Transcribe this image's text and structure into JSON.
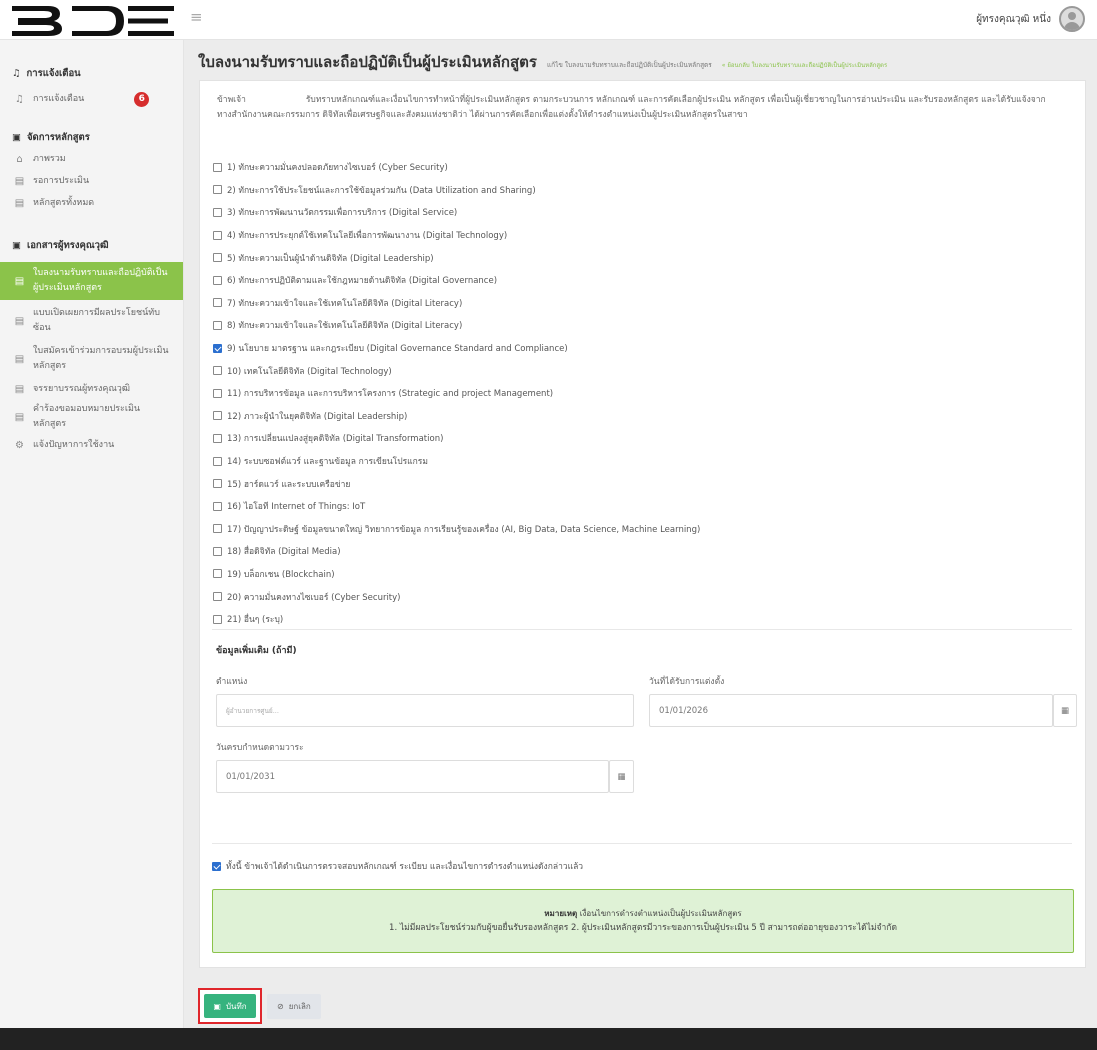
{
  "app": {
    "logo_text": "BDE",
    "user_name": "ผู้ทรงคุณวุฒิ หนึ่ง"
  },
  "sidebar": {
    "section_notifications": "การแจ้งเตือน",
    "item_notifications": "การแจ้งเตือน",
    "notification_count": "6",
    "section_curriculum": "จัดการหลักสูตร",
    "item_overview": "ภาพรวม",
    "item_pending": "รอการประเมิน",
    "item_all_courses": "หลักสูตรทั้งหมด",
    "section_documents": "เอกสารผู้ทรงคุณวุฒิ",
    "item_acknowledgement": "ใบลงนามรับทราบและถือปฏิบัติเป็นผู้ประเมินหลักสูตร",
    "item_conflict": "แบบเปิดเผยการมีผลประโยชน์ทับซ้อน",
    "item_training": "ใบสมัครเข้าร่วมการอบรมผู้ประเมินหลักสูตร",
    "item_ethics": "จรรยาบรรณผู้ทรงคุณวุฒิ",
    "item_assignment": "คำร้องขอมอบหมายประเมินหลักสูตร",
    "item_report": "แจ้งปัญหาการใช้งาน"
  },
  "page": {
    "title": "ใบลงนามรับทราบและถือปฏิบัติเป็นผู้ประเมินหลักสูตร",
    "subtitle": "แก้ไข ใบลงนามรับทราบและถือปฏิบัติเป็นผู้ประเมินหลักสูตร",
    "breadcrumb": "« ย้อนกลับ ใบลงนามรับทราบและถือปฏิบัติเป็นผู้ประเมินหลักสูตร"
  },
  "form": {
    "intro_prefix": "ข้าพเจ้า",
    "intro_text": "รับทราบหลักเกณฑ์และเงื่อนไขการทำหน้าที่ผู้ประเมินหลักสูตร ตามกระบวนการ หลักเกณฑ์ และการคัดเลือกผู้ประเมิน หลักสูตร เพื่อเป็นผู้เชี่ยวชาญในการอ่านประเมิน และรับรองหลักสูตร และได้รับแจ้งจาก",
    "intro_text2": "ทางสำนักงานคณะกรรมการ ดิจิทัลเพื่อเศรษฐกิจและสังคมแห่งชาติว่า ได้ผ่านการคัดเลือกเพื่อแต่งตั้งให้ดำรงตำแหน่งเป็นผู้ประเมินหลักสูตรในสาขา",
    "skills": [
      {
        "label": "1) ทักษะความมั่นคงปลอดภัยทางไซเบอร์ (Cyber Security)",
        "checked": false
      },
      {
        "label": "2) ทักษะการใช้ประโยชน์และการใช้ข้อมูลร่วมกัน (Data Utilization and Sharing)",
        "checked": false
      },
      {
        "label": "3) ทักษะการพัฒนานวัตกรรมเพื่อการบริการ (Digital Service)",
        "checked": false
      },
      {
        "label": "4) ทักษะการประยุกต์ใช้เทคโนโลยีเพื่อการพัฒนางาน (Digital Technology)",
        "checked": false
      },
      {
        "label": "5) ทักษะความเป็นผู้นำด้านดิจิทัล (Digital Leadership)",
        "checked": false
      },
      {
        "label": "6) ทักษะการปฏิบัติตามและใช้กฎหมายด้านดิจิทัล (Digital Governance)",
        "checked": false
      },
      {
        "label": "7) ทักษะความเข้าใจและใช้เทคโนโลยีดิจิทัล (Digital Literacy)",
        "checked": false
      },
      {
        "label": "8) ทักษะความเข้าใจและใช้เทคโนโลยีดิจิทัล (Digital Literacy)",
        "checked": false
      },
      {
        "label": "9) นโยบาย มาตรฐาน และกฎระเบียบ (Digital Governance Standard and Compliance)",
        "checked": true
      },
      {
        "label": "10) เทคโนโลยีดิจิทัล (Digital Technology)",
        "checked": false
      },
      {
        "label": "11) การบริหารข้อมูล และการบริหารโครงการ (Strategic and project Management)",
        "checked": false
      },
      {
        "label": "12) ภาวะผู้นำในยุคดิจิทัล (Digital Leadership)",
        "checked": false
      },
      {
        "label": "13) การเปลี่ยนแปลงสู่ยุคดิจิทัล (Digital Transformation)",
        "checked": false
      },
      {
        "label": "14) ระบบซอฟต์แวร์ และฐานข้อมูล การเขียนโปรแกรม",
        "checked": false
      },
      {
        "label": "15) ฮาร์ดแวร์ และระบบเครือข่าย",
        "checked": false
      },
      {
        "label": "16) ไอโอที Internet of Things: IoT",
        "checked": false
      },
      {
        "label": "17) ปัญญาประดิษฐ์ ข้อมูลขนาดใหญ่ วิทยาการข้อมูล การเรียนรู้ของเครื่อง (AI, Big Data, Data Science, Machine Learning)",
        "checked": false
      },
      {
        "label": "18) สื่อดิจิทัล (Digital Media)",
        "checked": false
      },
      {
        "label": "19) บล็อกเชน (Blockchain)",
        "checked": false
      },
      {
        "label": "20) ความมั่นคงทางไซเบอร์ (Cyber Security)",
        "checked": false
      },
      {
        "label": "21) อื่นๆ (ระบุ)",
        "checked": false
      }
    ],
    "additional_heading": "ข้อมูลเพิ่มเติม (ถ้ามี)",
    "position_label": "ตำแหน่ง",
    "position_placeholder": "ผู้อำนวยการศูนย์...",
    "appointment_label": "วันที่ได้รับการแต่งตั้ง",
    "appointment_value": "01/01/2026",
    "term_label": "วันครบกำหนดตามวาระ",
    "term_value": "01/01/2031",
    "confirm_label": "ทั้งนี้ ข้าพเจ้าได้ดำเนินการตรวจสอบหลักเกณฑ์ ระเบียบ และเงื่อนไขการดำรงตำแหน่งดังกล่าวแล้ว",
    "confirm_checked": true,
    "note_title": "หมายเหตุ",
    "note_title_rest": "เงื่อนไขการดำรงตำแหน่งเป็นผู้ประเมินหลักสูตร",
    "note_body": "1. ไม่มีผลประโยชน์ร่วมกับผู้ขอยื่นรับรองหลักสูตร 2. ผู้ประเมินหลักสูตรมีวาระของการเป็นผู้ประเมิน 5 ปี สามารถต่ออายุของวาระได้ไม่จำกัด"
  },
  "actions": {
    "save_label": "บันทึก",
    "cancel_label": "ยกเลิก"
  },
  "colors": {
    "accent": "#8bc34a",
    "save": "#36b37e",
    "badge": "#d62d2d",
    "highlight": "#e0262b"
  }
}
